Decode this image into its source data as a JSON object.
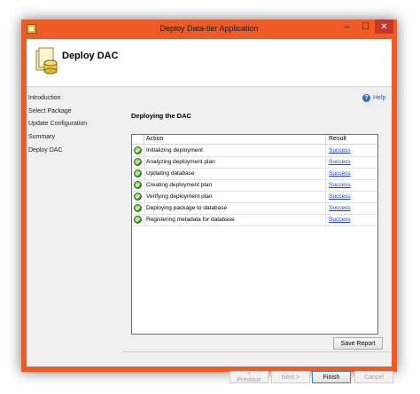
{
  "window": {
    "title": "Deploy Data-tier Application",
    "controls": {
      "minimize": "–",
      "maximize": "☐",
      "close": "✕"
    }
  },
  "header": {
    "title": "Deploy DAC"
  },
  "nav": {
    "items": [
      {
        "label": "Introduction"
      },
      {
        "label": "Select Package"
      },
      {
        "label": "Update Configuration"
      },
      {
        "label": "Summary"
      },
      {
        "label": "Deploy DAC"
      }
    ]
  },
  "help": {
    "label": "Help"
  },
  "main": {
    "section_title": "Deploying the DAC",
    "columns": {
      "action": "Action",
      "result": "Result"
    },
    "rows": [
      {
        "action": "Initializing deployment",
        "result": "Success"
      },
      {
        "action": "Analyzing deployment plan",
        "result": "Success"
      },
      {
        "action": "Updating database",
        "result": "Success"
      },
      {
        "action": "Creating deployment plan",
        "result": "Success"
      },
      {
        "action": "Verifying deployment plan",
        "result": "Success"
      },
      {
        "action": "Deploying package to database",
        "result": "Success"
      },
      {
        "action": "Registering metadata for database",
        "result": "Success"
      }
    ],
    "save_report_label": "Save Report"
  },
  "footer": {
    "previous_label": "< Previous",
    "next_label": "Next >",
    "finish_label": "Finish",
    "cancel_label": "Cancel"
  },
  "colors": {
    "frame_accent": "#f05a24",
    "link": "#1a3fd6",
    "success_icon": "#3a9a1a"
  },
  "icons": {
    "app": "database-package-icon",
    "header": "dac-package-icon",
    "help": "help-icon",
    "row_status": "success-check-icon"
  }
}
